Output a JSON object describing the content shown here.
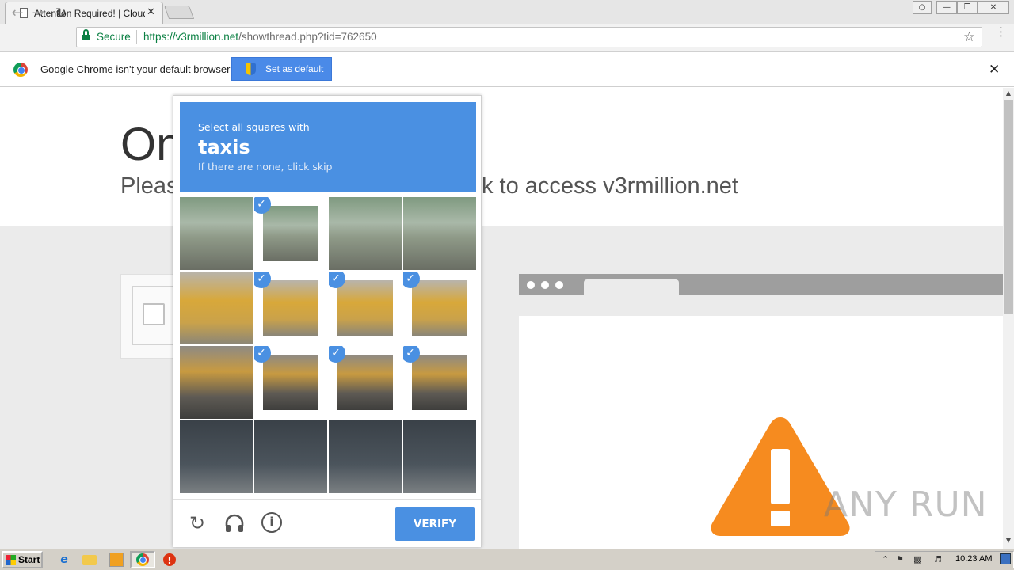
{
  "browser": {
    "tab_title": "Attention Required! | Cloudflare",
    "tab_close": "✕",
    "secure_label": "Secure",
    "url_host": "https://v3rmillion.net",
    "url_path": "/showthread.php?tid=762650",
    "nav": {
      "back": "←",
      "forward": "→",
      "reload": "↻"
    },
    "star": "☆",
    "menu": "⋮"
  },
  "infobar": {
    "message": "Google Chrome isn't your default browser",
    "button_label": "Set as default",
    "close": "✕"
  },
  "page": {
    "headline": "On",
    "subline_start": "Pleas",
    "subline_end": "k to access v3rmillion.net"
  },
  "challenge": {
    "instruction": "Select all squares with",
    "target": "taxis",
    "skip_hint": "If there are none, click skip",
    "verify_label": "VERIFY",
    "icons": {
      "reload": "reload-icon",
      "audio": "headphones-icon",
      "info": "info-icon"
    },
    "tiles": [
      {
        "row": 0,
        "col": 0,
        "selected": false
      },
      {
        "row": 0,
        "col": 1,
        "selected": true
      },
      {
        "row": 0,
        "col": 2,
        "selected": false
      },
      {
        "row": 0,
        "col": 3,
        "selected": false
      },
      {
        "row": 1,
        "col": 0,
        "selected": false
      },
      {
        "row": 1,
        "col": 1,
        "selected": true
      },
      {
        "row": 1,
        "col": 2,
        "selected": true
      },
      {
        "row": 1,
        "col": 3,
        "selected": true
      },
      {
        "row": 2,
        "col": 0,
        "selected": false
      },
      {
        "row": 2,
        "col": 1,
        "selected": true
      },
      {
        "row": 2,
        "col": 2,
        "selected": true
      },
      {
        "row": 2,
        "col": 3,
        "selected": true
      },
      {
        "row": 3,
        "col": 0,
        "selected": false
      },
      {
        "row": 3,
        "col": 1,
        "selected": false
      },
      {
        "row": 3,
        "col": 2,
        "selected": false
      },
      {
        "row": 3,
        "col": 3,
        "selected": false
      }
    ],
    "colors": {
      "header": "#4a90e2",
      "verify": "#4a90e2"
    }
  },
  "watermark": "ANY RUN",
  "taskbar": {
    "start_label": "Start",
    "clock": "10:23 AM"
  }
}
